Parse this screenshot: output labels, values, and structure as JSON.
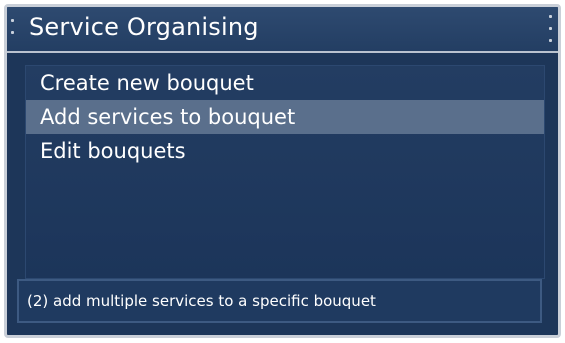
{
  "window": {
    "title": "Service Organising"
  },
  "menu": {
    "items": [
      {
        "label": "Create new bouquet",
        "selected": false
      },
      {
        "label": "Add services to bouquet",
        "selected": true
      },
      {
        "label": "Edit bouquets",
        "selected": false
      }
    ]
  },
  "help": {
    "text": "(2) add multiple services to a specific bouquet"
  },
  "colors": {
    "background": "#1d3659",
    "selection": "#5a6f8c",
    "text": "#ffffff"
  }
}
